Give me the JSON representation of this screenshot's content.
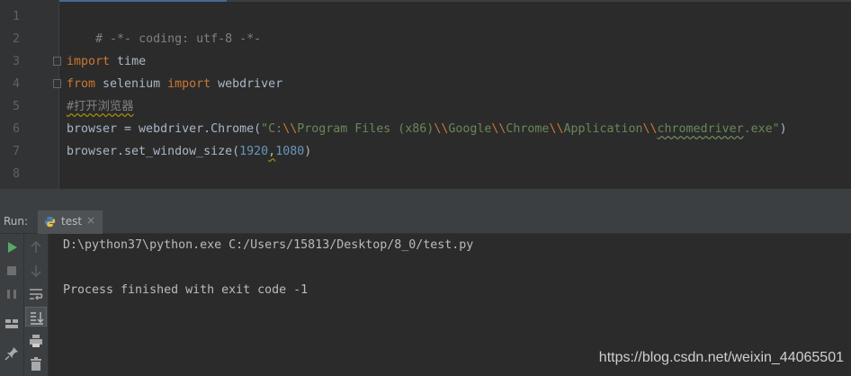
{
  "editor": {
    "line_numbers": [
      "1",
      "2",
      "3",
      "4",
      "5",
      "6",
      "7",
      "8"
    ],
    "lines": {
      "l1": "# -*- coding: utf-8 -*-",
      "l3_kw": "import",
      "l3_rest": " time",
      "l4_kw1": "from",
      "l4_mid": " selenium ",
      "l4_kw2": "import",
      "l4_rest": " webdriver",
      "l5": "#打开浏览器",
      "l6_a": "browser = webdriver.Chrome(",
      "l6_q1": "\"C:",
      "l6_e1": "\\\\",
      "l6_s1": "Program Files (x86)",
      "l6_e2": "\\\\",
      "l6_s2": "Google",
      "l6_e3": "\\\\",
      "l6_s3": "Chrome",
      "l6_e4": "\\\\",
      "l6_s4": "Application",
      "l6_e5": "\\\\",
      "l6_s5": "chromedriver",
      "l6_s6": ".exe\"",
      "l6_close": ")",
      "l7_a": "browser.set_window_size(",
      "l7_n1": "1920",
      "l7_comma": ",",
      "l7_n2": "1080",
      "l7_close": ")"
    }
  },
  "run": {
    "label": "Run:",
    "tab_name": "test",
    "tab_close": "×"
  },
  "console": {
    "line1": "D:\\python37\\python.exe C:/Users/15813/Desktop/8_0/test.py",
    "line2": "Process finished with exit code -1"
  },
  "watermark": "https://blog.csdn.net/weixin_44065501",
  "colors": {
    "keyword": "#cc7832",
    "comment": "#808080",
    "string": "#6a8759",
    "number": "#6897bb",
    "text": "#a9b7c6"
  },
  "icons": [
    "run-icon",
    "stop-icon",
    "pause-icon",
    "layout-icon",
    "pin-icon",
    "up-arrow-icon",
    "down-arrow-icon",
    "soft-wrap-icon",
    "scroll-to-end-icon",
    "print-icon",
    "trash-icon",
    "python-icon"
  ]
}
